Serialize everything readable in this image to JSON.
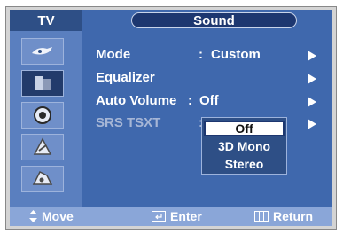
{
  "header": {
    "tab_label": "TV",
    "title": "Sound"
  },
  "sidebar": {
    "items": [
      {
        "icon": "picture-icon"
      },
      {
        "icon": "sound-icon",
        "active": true
      },
      {
        "icon": "channel-icon"
      },
      {
        "icon": "setup-icon"
      },
      {
        "icon": "input-icon"
      }
    ]
  },
  "menu": {
    "items": [
      {
        "label": "Mode",
        "colon": ":",
        "value": "Custom"
      },
      {
        "label": "Equalizer",
        "colon": "",
        "value": ""
      },
      {
        "label": "Auto Volume",
        "colon": ":",
        "value": "Off"
      },
      {
        "label": "SRS TSXT",
        "colon": ":",
        "value": ""
      }
    ]
  },
  "dropdown": {
    "options": [
      "Off",
      "3D Mono",
      "Stereo"
    ],
    "selected": "Off"
  },
  "footer": {
    "move": "Move",
    "enter": "Enter",
    "return": "Return"
  }
}
